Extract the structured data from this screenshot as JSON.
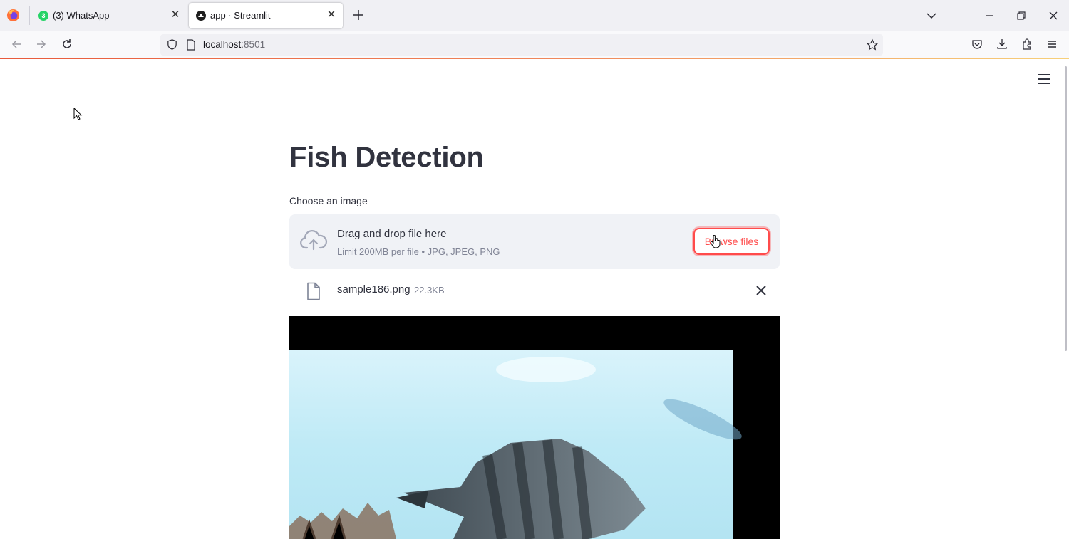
{
  "browser": {
    "tabs": [
      {
        "label": "(3) WhatsApp",
        "badge": "3",
        "active": false
      },
      {
        "label": "app · Streamlit",
        "active": true
      }
    ],
    "url_host": "localhost",
    "url_port": ":8501"
  },
  "app": {
    "title": "Fish Detection",
    "uploader": {
      "label": "Choose an image",
      "drop_text": "Drag and drop file here",
      "limit_text": "Limit 200MB per file • JPG, JPEG, PNG",
      "browse_label": "Browse files"
    },
    "uploaded_file": {
      "name": "sample186.png",
      "size": "22.3KB"
    }
  },
  "colors": {
    "accent": "#ff4b4b",
    "text": "#31333f",
    "muted": "#808495",
    "dropzone_bg": "#f0f2f6"
  },
  "icons": [
    "firefox-icon",
    "whatsapp-icon",
    "streamlit-icon",
    "close-icon",
    "plus-icon",
    "chevron-down-icon",
    "minimize-icon",
    "restore-icon",
    "back-icon",
    "forward-icon",
    "reload-icon",
    "shield-icon",
    "page-icon",
    "star-icon",
    "pocket-icon",
    "download-icon",
    "extensions-icon",
    "menu-icon",
    "cloud-upload-icon",
    "file-icon"
  ]
}
